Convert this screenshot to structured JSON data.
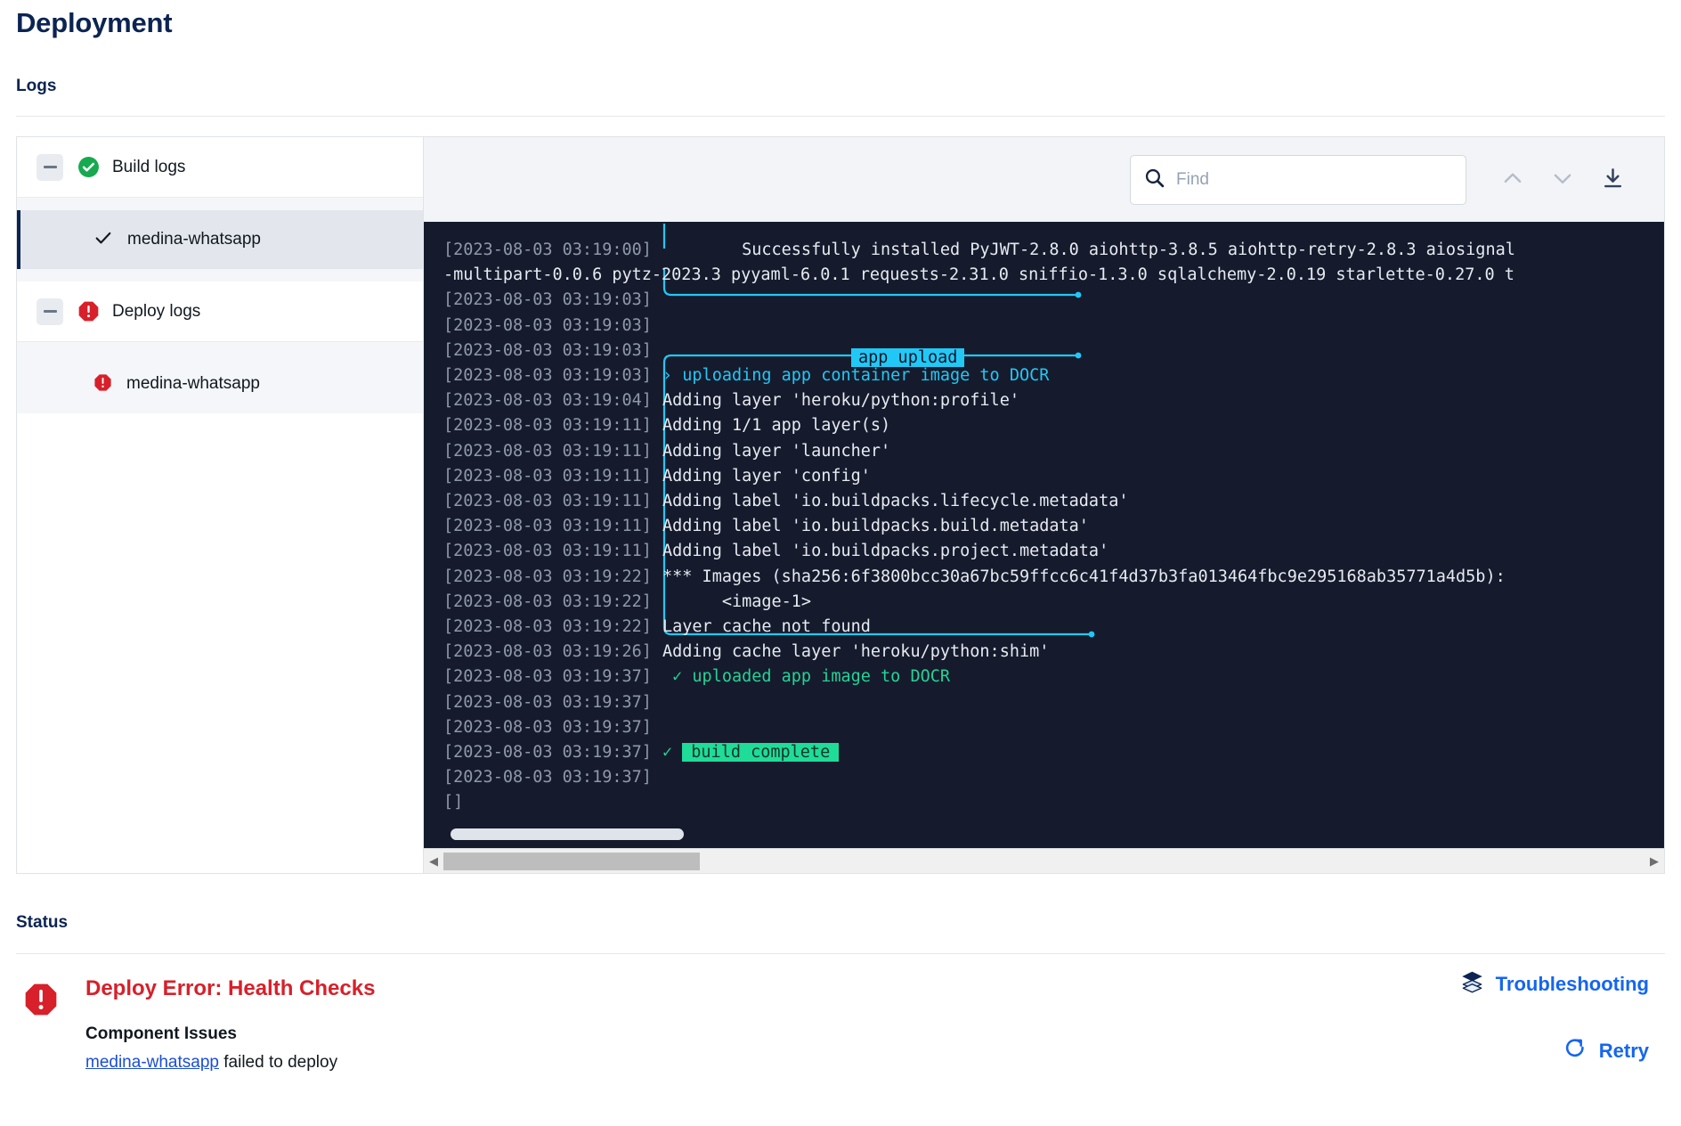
{
  "header": {
    "title": "Deployment"
  },
  "sections": {
    "logs_label": "Logs",
    "status_label": "Status"
  },
  "tree": {
    "groups": [
      {
        "label": "Build logs",
        "status_icon": "success-check-circle-icon",
        "expander_icon": "collapse-minus-icon",
        "children": [
          {
            "label": "medina-whatsapp",
            "icon": "check-icon",
            "selected": true
          }
        ]
      },
      {
        "label": "Deploy logs",
        "status_icon": "error-octagon-icon",
        "expander_icon": "collapse-minus-icon",
        "children": [
          {
            "label": "medina-whatsapp",
            "icon": "error-octagon-icon",
            "selected": false
          }
        ]
      }
    ]
  },
  "toolbar": {
    "search_placeholder": "Find",
    "search_value": "",
    "search_icon": "search-icon",
    "prev_icon": "chevron-up-icon",
    "next_icon": "chevron-down-icon",
    "download_icon": "download-icon"
  },
  "terminal": {
    "lines": [
      {
        "ts": "[2023-08-03 03:19:00]",
        "text": "        Successfully installed PyJWT-2.8.0 aiohttp-3.8.5 aiohttp-retry-2.8.3 aiosignal"
      },
      {
        "ts": "",
        "text": "-multipart-0.0.6 pytz-2023.3 pyyaml-6.0.1 requests-2.31.0 sniffio-1.3.0 sqlalchemy-2.0.19 starlette-0.27.0 t",
        "continuation": true
      },
      {
        "ts": "[2023-08-03 03:19:03]",
        "text": ""
      },
      {
        "ts": "[2023-08-03 03:19:03]",
        "text": ""
      },
      {
        "ts": "[2023-08-03 03:19:03]",
        "text": ""
      },
      {
        "ts": "[2023-08-03 03:19:03]",
        "text": "› uploading app container image to DOCR",
        "style": "cyan"
      },
      {
        "ts": "[2023-08-03 03:19:04]",
        "text": "Adding layer 'heroku/python:profile'"
      },
      {
        "ts": "[2023-08-03 03:19:11]",
        "text": "Adding 1/1 app layer(s)"
      },
      {
        "ts": "[2023-08-03 03:19:11]",
        "text": "Adding layer 'launcher'"
      },
      {
        "ts": "[2023-08-03 03:19:11]",
        "text": "Adding layer 'config'"
      },
      {
        "ts": "[2023-08-03 03:19:11]",
        "text": "Adding label 'io.buildpacks.lifecycle.metadata'"
      },
      {
        "ts": "[2023-08-03 03:19:11]",
        "text": "Adding label 'io.buildpacks.build.metadata'"
      },
      {
        "ts": "[2023-08-03 03:19:11]",
        "text": "Adding label 'io.buildpacks.project.metadata'"
      },
      {
        "ts": "[2023-08-03 03:19:22]",
        "text": "*** Images (sha256:6f3800bcc30a67bc59ffcc6c41f4d37b3fa013464fbc9e295168ab35771a4d5b):"
      },
      {
        "ts": "[2023-08-03 03:19:22]",
        "text": "      <image-1>"
      },
      {
        "ts": "[2023-08-03 03:19:22]",
        "text": "Layer cache not found"
      },
      {
        "ts": "[2023-08-03 03:19:26]",
        "text": "Adding cache layer 'heroku/python:shim'"
      },
      {
        "ts": "[2023-08-03 03:19:37]",
        "text": " ✓ uploaded app image to DOCR",
        "style": "green"
      },
      {
        "ts": "[2023-08-03 03:19:37]",
        "text": ""
      },
      {
        "ts": "[2023-08-03 03:19:37]",
        "text": ""
      },
      {
        "ts": "[2023-08-03 03:19:37]",
        "text": "",
        "badge": "build complete",
        "badge_prefix": "✓",
        "badge_style": "green"
      },
      {
        "ts": "[2023-08-03 03:19:37]",
        "text": ""
      },
      {
        "ts": "[]",
        "text": ""
      }
    ],
    "badges": [
      {
        "label": "app upload",
        "style": "cyan"
      },
      {
        "label": "build complete",
        "style": "green"
      }
    ]
  },
  "status": {
    "error_title": "Deploy Error: Health Checks",
    "error_icon": "error-octagon-icon",
    "component_issues_label": "Component Issues",
    "component_link": "medina-whatsapp",
    "component_text": " failed to deploy",
    "troubleshooting_label": "Troubleshooting",
    "troubleshooting_icon": "layers-icon",
    "retry_label": "Retry",
    "retry_icon": "refresh-icon"
  },
  "colors": {
    "accent_blue": "#1565f0",
    "error_red": "#d7202a",
    "success_green": "#17a94f",
    "terminal_bg": "#151b2d",
    "cyan": "#22c8f5",
    "green": "#1fdc98",
    "title_navy": "#0b2452"
  }
}
